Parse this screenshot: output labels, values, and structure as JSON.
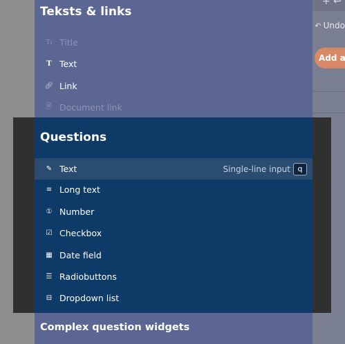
{
  "background": {
    "undo_label": "Undo",
    "add_button_label": "Add a n"
  },
  "sections": {
    "texts_links": {
      "title": "Teksts & links",
      "items": [
        {
          "label": "Title",
          "icon": "title-icon"
        },
        {
          "label": "Text",
          "icon": "text-icon"
        },
        {
          "label": "Link",
          "icon": "link-icon"
        },
        {
          "label": "Document link",
          "icon": "document-link-icon"
        }
      ]
    },
    "questions": {
      "title": "Questions",
      "items": [
        {
          "label": "Text",
          "icon": "pencil-icon",
          "hint": "Single-line input",
          "shortcut": "q"
        },
        {
          "label": "Long text",
          "icon": "lines-icon"
        },
        {
          "label": "Number",
          "icon": "number-icon"
        },
        {
          "label": "Checkbox",
          "icon": "checkbox-icon"
        },
        {
          "label": "Date field",
          "icon": "calendar-icon"
        },
        {
          "label": "Radiobuttons",
          "icon": "list-icon"
        },
        {
          "label": "Dropdown list",
          "icon": "dropdown-icon"
        }
      ]
    },
    "complex": {
      "title": "Complex question widgets"
    }
  },
  "colors": {
    "panel": "#5c6692",
    "questions_panel": "#0d3a66",
    "selected_row": "#2a4c71",
    "accent_button": "#d88a68"
  }
}
